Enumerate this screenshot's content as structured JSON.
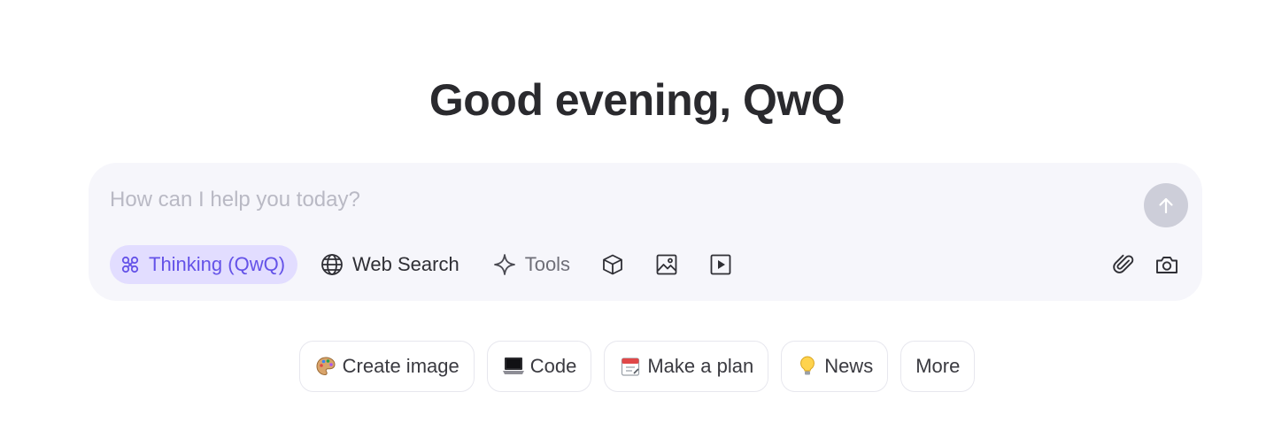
{
  "greeting": "Good evening, QwQ",
  "composer": {
    "placeholder": "How can I help you today?",
    "value": ""
  },
  "toolbar": {
    "thinking_label": "Thinking (QwQ)",
    "web_search_label": "Web Search",
    "tools_label": "Tools"
  },
  "icons": {
    "thinking": "thinking-icon",
    "globe": "globe-icon",
    "sparkle": "sparkle-icon",
    "cube": "cube-icon",
    "image": "image-icon",
    "video": "video-play-icon",
    "attach": "paperclip-icon",
    "camera": "camera-icon",
    "send": "arrow-up-icon"
  },
  "suggestions": [
    {
      "label": "Create image",
      "icon": "palette-icon"
    },
    {
      "label": "Code",
      "icon": "laptop-icon"
    },
    {
      "label": "Make a plan",
      "icon": "calendar-icon"
    },
    {
      "label": "News",
      "icon": "lightbulb-icon"
    },
    {
      "label": "More",
      "icon": ""
    }
  ],
  "colors": {
    "accent": "#6452e8",
    "accent_bg": "#e2ddff",
    "composer_bg": "#f6f6fb",
    "send_disabled": "#cdced9"
  }
}
